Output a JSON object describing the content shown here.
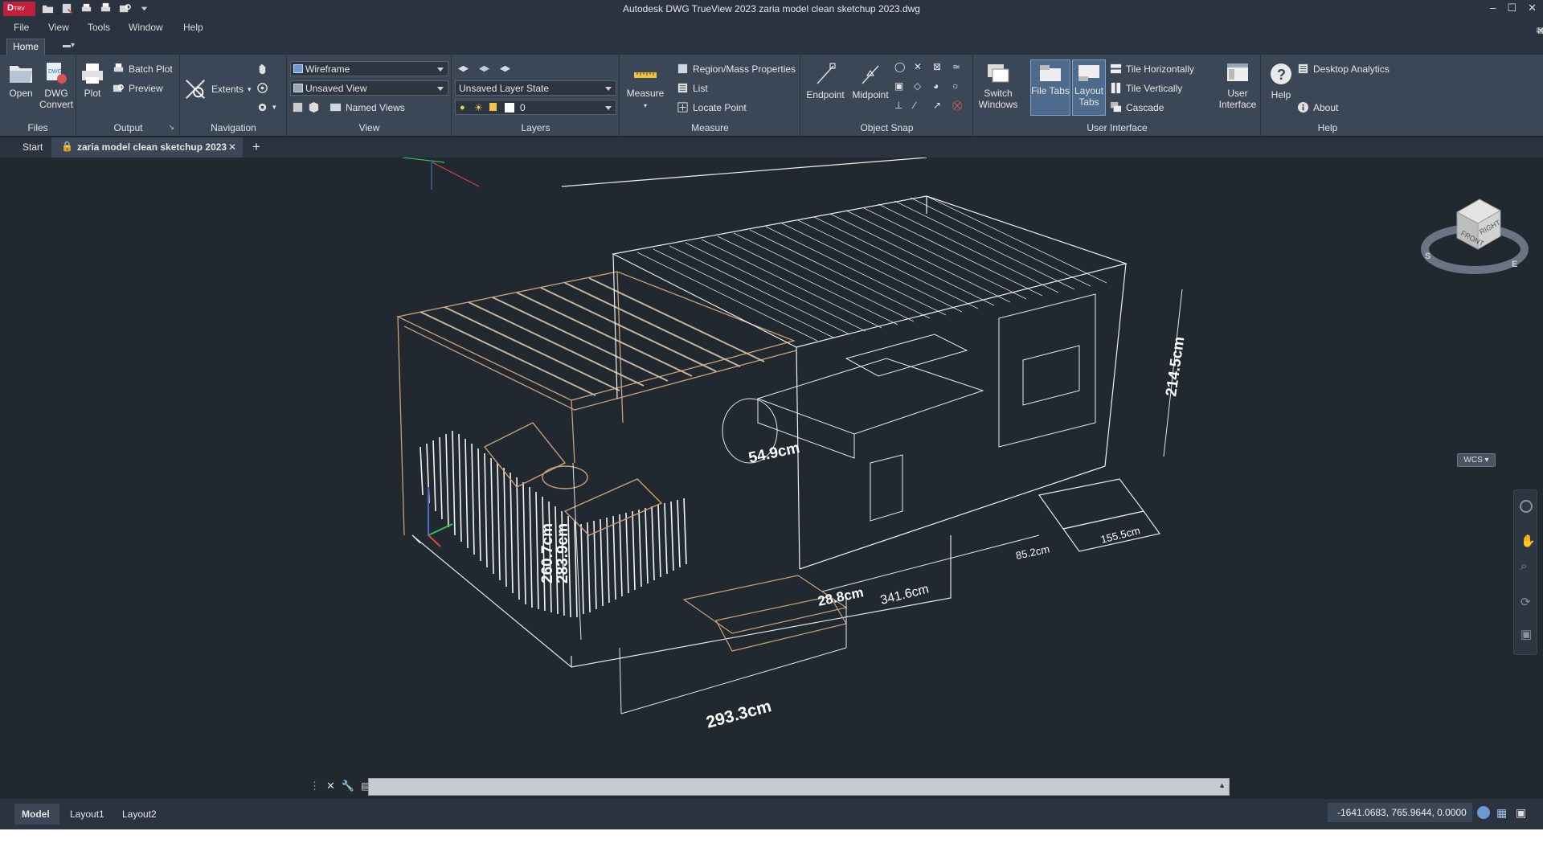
{
  "app": {
    "logo_text": "D",
    "logo_sub": "TRV",
    "title": "Autodesk DWG TrueView 2023    zaria model clean sketchup 2023.dwg"
  },
  "menu": [
    "File",
    "View",
    "Tools",
    "Window",
    "Help"
  ],
  "ribbon_tabs": {
    "home": "Home"
  },
  "ribbon": {
    "files": {
      "title": "Files",
      "open": "Open",
      "dwg_convert_1": "DWG",
      "dwg_convert_2": "Convert"
    },
    "output": {
      "title": "Output",
      "plot": "Plot",
      "batch_plot": "Batch Plot",
      "preview": "Preview"
    },
    "navigation": {
      "title": "Navigation",
      "extents": "Extents"
    },
    "view": {
      "title": "View",
      "visual_style": "Wireframe",
      "named_view": "Unsaved View",
      "named_views": "Named Views"
    },
    "layers": {
      "title": "Layers",
      "layer_state": "Unsaved Layer State",
      "current_layer": "0"
    },
    "measure": {
      "title": "Measure",
      "measure": "Measure",
      "region_mass": "Region/Mass Properties",
      "list": "List",
      "locate_point": "Locate Point"
    },
    "object_snap": {
      "title": "Object Snap",
      "endpoint": "Endpoint",
      "midpoint": "Midpoint"
    },
    "user_interface": {
      "title": "User Interface",
      "switch_windows_1": "Switch",
      "switch_windows_2": "Windows",
      "file_tabs": "File Tabs",
      "layout_tabs_1": "Layout",
      "layout_tabs_2": "Tabs",
      "tile_h": "Tile Horizontally",
      "tile_v": "Tile Vertically",
      "cascade": "Cascade",
      "user_interface_1": "User",
      "user_interface_2": "Interface"
    },
    "help": {
      "title": "Help",
      "help": "Help",
      "desktop_analytics": "Desktop Analytics",
      "about": "About"
    }
  },
  "doc_tabs": {
    "start": "Start",
    "active": "zaria model clean sketchup 2023",
    "add": "+"
  },
  "drawing": {
    "dimensions": [
      "214.5cm",
      "54.9cm",
      "28.8cm",
      "341.6cm",
      "293.3cm",
      "85.2cm",
      "155.5cm",
      "260.7cm",
      "283.9cm"
    ],
    "viewcube": {
      "front": "FRONT",
      "right": "RIGHT",
      "compass_s": "S",
      "compass_e": "E",
      "wcs": "WCS"
    }
  },
  "layout_tabs": [
    "Model",
    "Layout1",
    "Layout2"
  ],
  "status": {
    "coordinates": "-1641.0683, 765.9644, 0.0000"
  },
  "colors": {
    "accent_logo": "#c21f3a",
    "background": "#212830",
    "ribbon": "#3b4656",
    "wood": "#c8a27a"
  }
}
